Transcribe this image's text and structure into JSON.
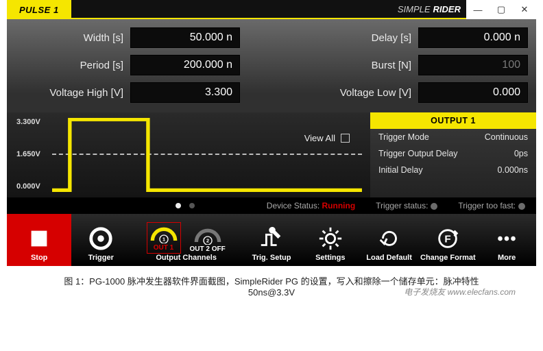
{
  "titlebar": {
    "tab": "PULSE 1",
    "brand_light": "SIMPLE",
    "brand_bold": "RIDER",
    "win_min": "—",
    "win_max": "▢",
    "win_close": "✕"
  },
  "params": {
    "width_label": "Width [s]",
    "width_value": "50.000 n",
    "delay_label": "Delay [s]",
    "delay_value": "0.000 n",
    "period_label": "Period [s]",
    "period_value": "200.000 n",
    "burst_label": "Burst [N]",
    "burst_value": "100",
    "vhigh_label": "Voltage High [V]",
    "vhigh_value": "3.300",
    "vlow_label": "Voltage Low [V]",
    "vlow_value": "0.000"
  },
  "wave": {
    "y_top": "3.300V",
    "y_mid": "1.650V",
    "y_bot": "0.000V",
    "viewall": "View All"
  },
  "output_panel": {
    "title": "OUTPUT 1",
    "rows": [
      {
        "k": "Trigger Mode",
        "v": "Continuous"
      },
      {
        "k": "Trigger Output Delay",
        "v": "0ps"
      },
      {
        "k": "Initial Delay",
        "v": "0.000ns"
      }
    ]
  },
  "status": {
    "device_label": "Device Status:",
    "device_value": "Running",
    "trig_status": "Trigger status:",
    "trig_fast": "Trigger too fast:"
  },
  "toolbar": {
    "stop": "Stop",
    "trigger": "Trigger",
    "out1": "OUT 1",
    "out2": "OUT 2 OFF",
    "out_group": "Output Channels",
    "trig_setup": "Trig. Setup",
    "settings": "Settings",
    "load_default": "Load Default",
    "change_format": "Change Format",
    "more": "More"
  },
  "caption": {
    "line1": "图 1：PG-1000 脉冲发生器软件界面截图，SimpleRider PG 的设置，写入和擦除一个储存单元：脉冲特性",
    "line2": "50ns@3.3V",
    "wm": "电子发烧友  www.elecfans.com"
  }
}
